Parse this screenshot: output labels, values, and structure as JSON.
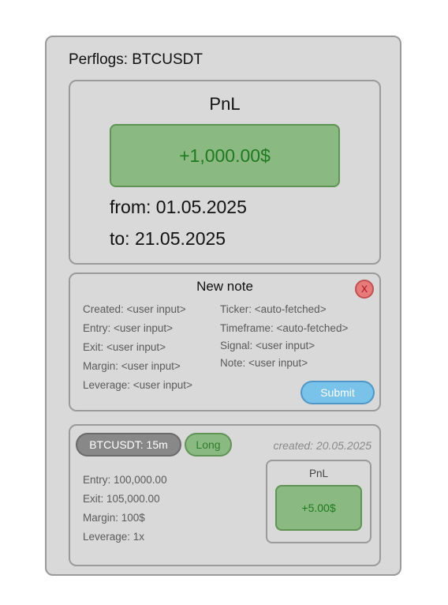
{
  "app": {
    "title": "Perflogs: BTCUSDT"
  },
  "pnl_summary": {
    "title": "PnL",
    "value": "+1,000.00$",
    "from": "from: 01.05.2025",
    "to": "to: 21.05.2025"
  },
  "new_note": {
    "title": "New note",
    "close_label": "X",
    "left_fields": [
      "Created: <user input>",
      "Entry: <user input>",
      "Exit: <user input>",
      "Margin: <user input>",
      "Leverage: <user input>"
    ],
    "right_fields": [
      "Ticker: <auto-fetched>",
      "Timeframe: <auto-fetched>",
      "Signal: <user input>",
      "Note: <user input>"
    ],
    "submit_label": "Submit"
  },
  "entries": [
    {
      "ticker_label": "BTCUSDT: 15m",
      "side": "Long",
      "created": "created: 20.05.2025",
      "entry": "Entry: 100,000.00",
      "exit": "Exit: 105,000.00",
      "margin": "Margin: 100$",
      "leverage": "Leverage: 1x",
      "pnl_title": "PnL",
      "pnl_value": "+5.00$"
    }
  ],
  "colors": {
    "panel_bg": "#d9d9d9",
    "border": "#9a9a9a",
    "profit_fill": "#8aba81",
    "profit_text": "#1f7a1f",
    "close_fill": "#e87a7a",
    "submit_fill": "#79c2ea",
    "ticker_fill": "#888888"
  },
  "icons": {
    "close": "close-icon"
  }
}
